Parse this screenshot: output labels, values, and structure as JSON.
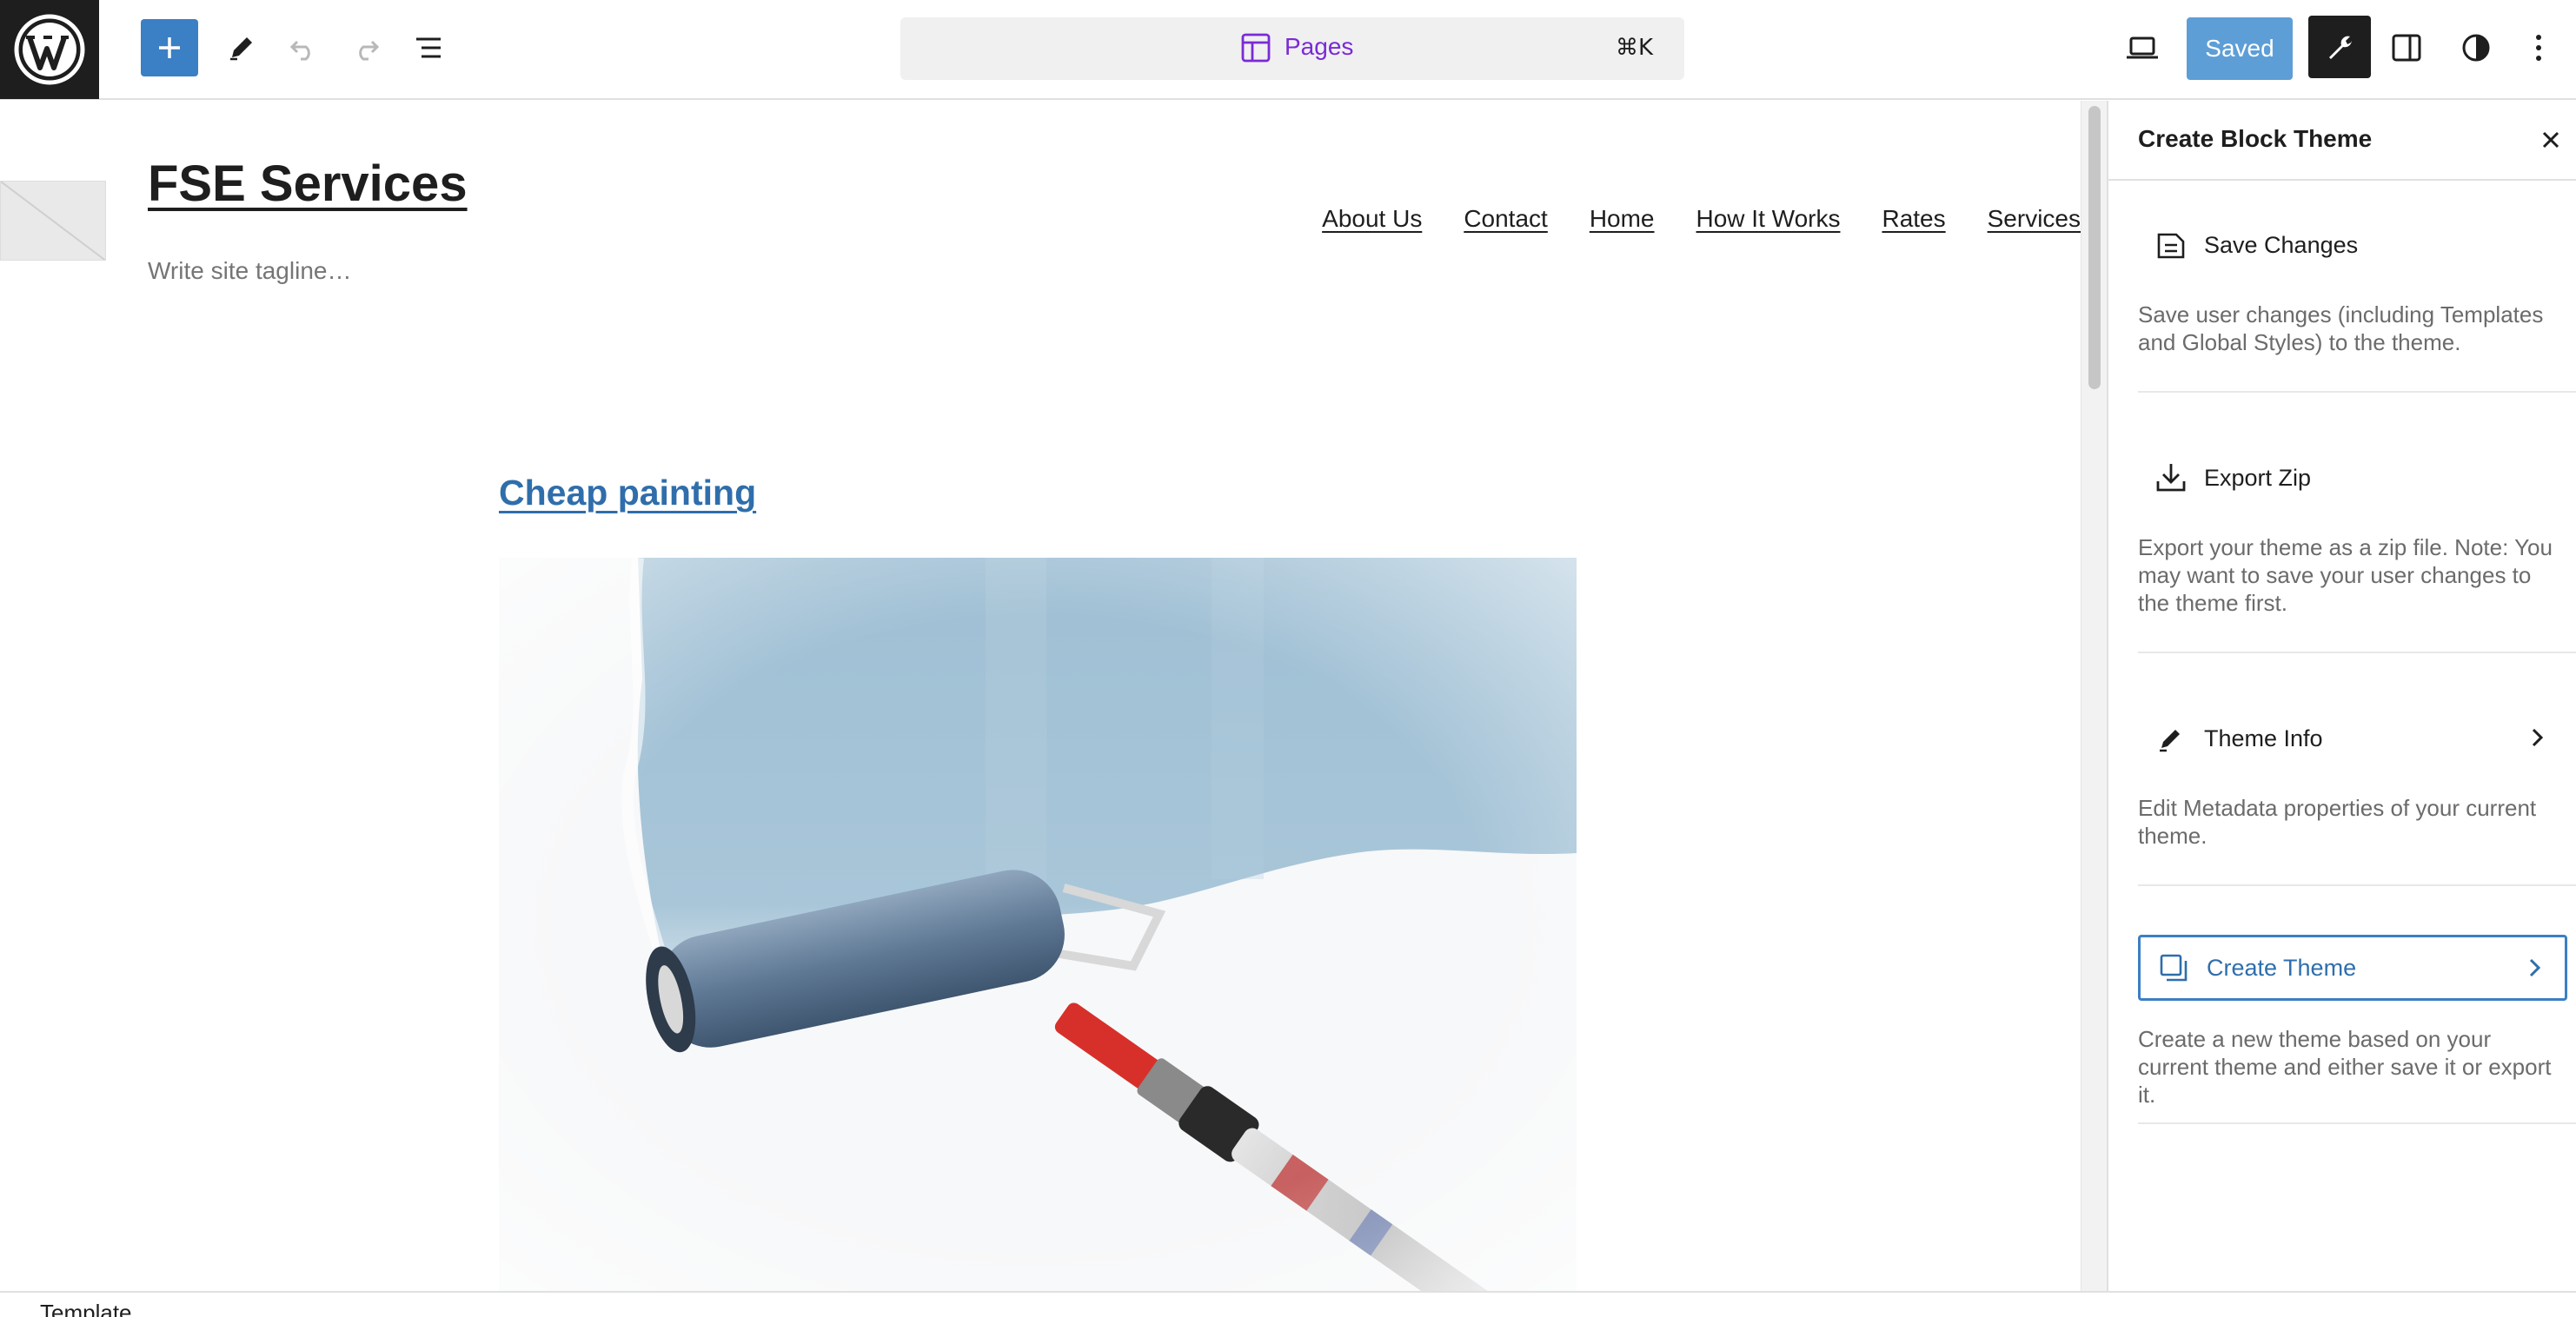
{
  "toolbar": {
    "add_label": "Add block",
    "command": {
      "label": "Pages",
      "shortcut": "⌘K"
    },
    "saved_label": "Saved"
  },
  "site": {
    "title": "FSE Services",
    "tagline_placeholder": "Write site tagline…",
    "nav": [
      "About Us",
      "Contact",
      "Home",
      "How It Works",
      "Rates",
      "Services"
    ]
  },
  "post": {
    "title": "Cheap painting",
    "image_alt": "Paint roller painting a wall blue"
  },
  "sidebar": {
    "title": "Create Block Theme",
    "items": [
      {
        "label": "Save Changes",
        "icon": "save-icon",
        "description": "Save user changes (including Templates and Global Styles) to the theme.",
        "has_chevron": false
      },
      {
        "label": "Export Zip",
        "icon": "download-icon",
        "description": "Export your theme as a zip file. Note: You may want to save your user changes to the theme first.",
        "has_chevron": false
      },
      {
        "label": "Theme Info",
        "icon": "pencil-icon",
        "description": "Edit Metadata properties of your current theme.",
        "has_chevron": true
      },
      {
        "label": "Create Theme",
        "icon": "copy-icon",
        "description": "Create a new theme based on your current theme and either save it or export it.",
        "has_chevron": true,
        "active": true
      }
    ]
  },
  "status": {
    "breadcrumb": "Template"
  },
  "colors": {
    "accent": "#3b7fc4",
    "link": "#2f6eab",
    "command_label": "#7a2ad6",
    "saved_bg": "#5e9ed6"
  }
}
